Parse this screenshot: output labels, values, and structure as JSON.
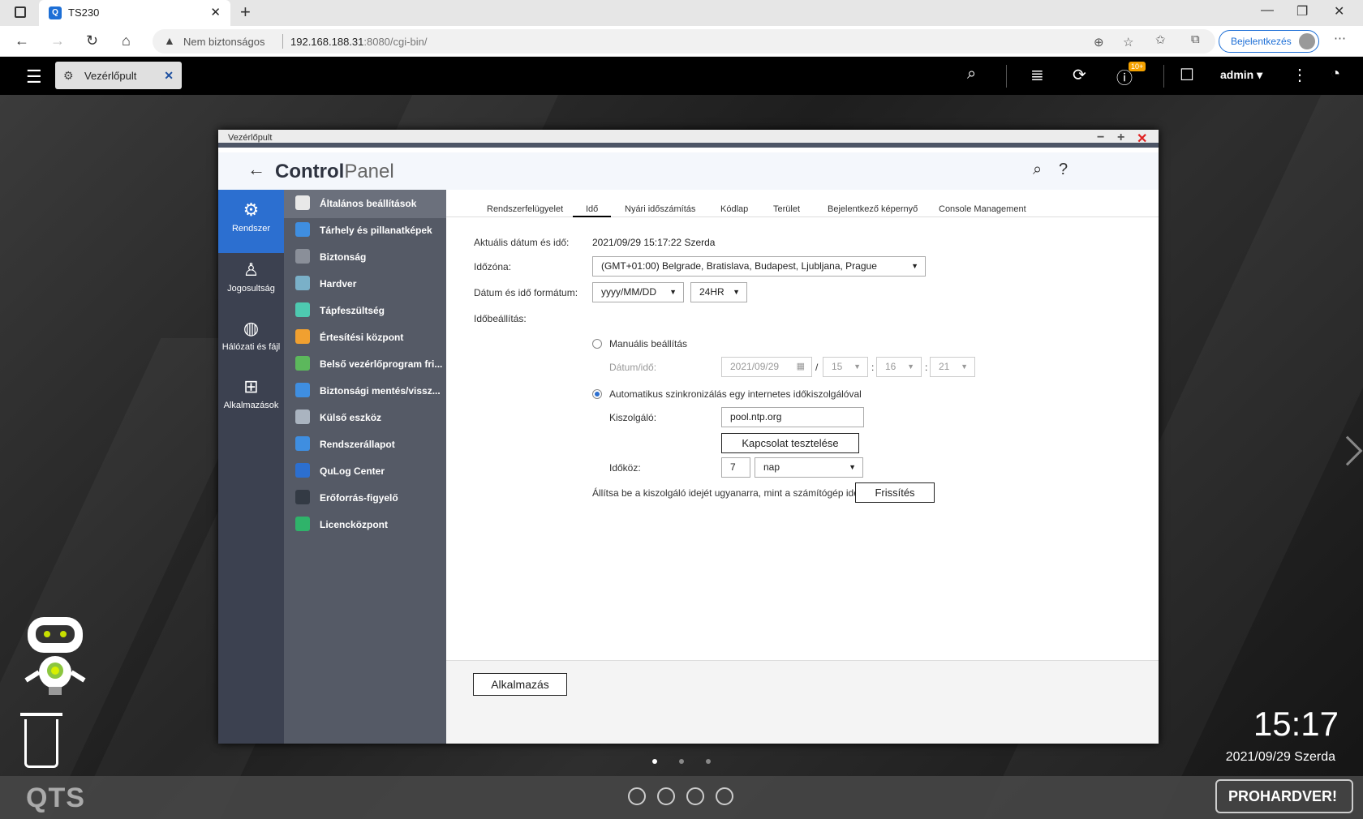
{
  "browser": {
    "tab_title": "TS230",
    "insecure_label": "Nem biztonságos",
    "host": "192.168.188.31",
    "port_path": ":8080/cgi-bin/",
    "signin_label": "Bejelentkezés"
  },
  "qts": {
    "app_tab_label": "Vezérlőpult",
    "notification_badge": "10+",
    "user": "admin"
  },
  "window": {
    "title": "Vezérlőpult",
    "cp_bold": "Control",
    "cp_light": "Panel"
  },
  "categories": [
    {
      "label": "Rendszer",
      "icon": "gear-icon"
    },
    {
      "label": "Jogosultság",
      "icon": "user-icon"
    },
    {
      "label": "Hálózati és fájl",
      "icon": "globe-icon"
    },
    {
      "label": "Alkalmazások",
      "icon": "apps-icon"
    }
  ],
  "menu": [
    {
      "label": "Általános beállítások",
      "color": "#e8e8e8"
    },
    {
      "label": "Tárhely és pillanatképek",
      "color": "#3f8ee0"
    },
    {
      "label": "Biztonság",
      "color": "#8a8f99"
    },
    {
      "label": "Hardver",
      "color": "#7ab0c8"
    },
    {
      "label": "Tápfeszültség",
      "color": "#4ec9b0"
    },
    {
      "label": "Értesítési központ",
      "color": "#f0a030"
    },
    {
      "label": "Belső vezérlőprogram fri...",
      "color": "#5cb85c"
    },
    {
      "label": "Biztonsági mentés/vissz...",
      "color": "#3f8ee0"
    },
    {
      "label": "Külső eszköz",
      "color": "#aab4c0"
    },
    {
      "label": "Rendszerállapot",
      "color": "#3f8ee0"
    },
    {
      "label": "QuLog Center",
      "color": "#2c6fd0"
    },
    {
      "label": "Erőforrás-figyelő",
      "color": "#333a44"
    },
    {
      "label": "Licencközpont",
      "color": "#2fb36a"
    }
  ],
  "tabs": [
    "Rendszerfelügyelet",
    "Idő",
    "Nyári időszámítás",
    "Kódlap",
    "Terület",
    "Bejelentkező képernyő",
    "Console Management"
  ],
  "form": {
    "current_label": "Aktuális dátum és idő:",
    "current_value": "2021/09/29 15:17:22 Szerda",
    "tz_label": "Időzóna:",
    "tz_value": "(GMT+01:00) Belgrade, Bratislava, Budapest, Ljubljana, Prague",
    "fmt_label": "Dátum és idő formátum:",
    "date_fmt": "yyyy/MM/DD",
    "time_fmt": "24HR",
    "timeset_label": "Időbeállítás:",
    "manual_label": "Manuális beállítás",
    "datetime_label": "Dátum/idő:",
    "manual_date": "2021/09/29",
    "manual_h": "15",
    "manual_m": "16",
    "manual_s": "21",
    "slash": "/",
    "colon": ":",
    "auto_label": "Automatikus szinkronizálás egy internetes időkiszolgálóval",
    "server_label": "Kiszolgáló:",
    "server_value": "pool.ntp.org",
    "test_btn": "Kapcsolat tesztelése",
    "interval_label": "Időköz:",
    "interval_value": "7",
    "interval_unit": "nap",
    "sync_text": "Állítsa be a kiszolgáló idejét ugyanarra, mint a számítógép ideje",
    "refresh_btn": "Frissítés",
    "apply_btn": "Alkalmazás"
  },
  "desktop": {
    "time": "15:17",
    "date": "2021/09/29 Szerda",
    "logo": "QTS",
    "watermark": "PROHARDVER!"
  }
}
